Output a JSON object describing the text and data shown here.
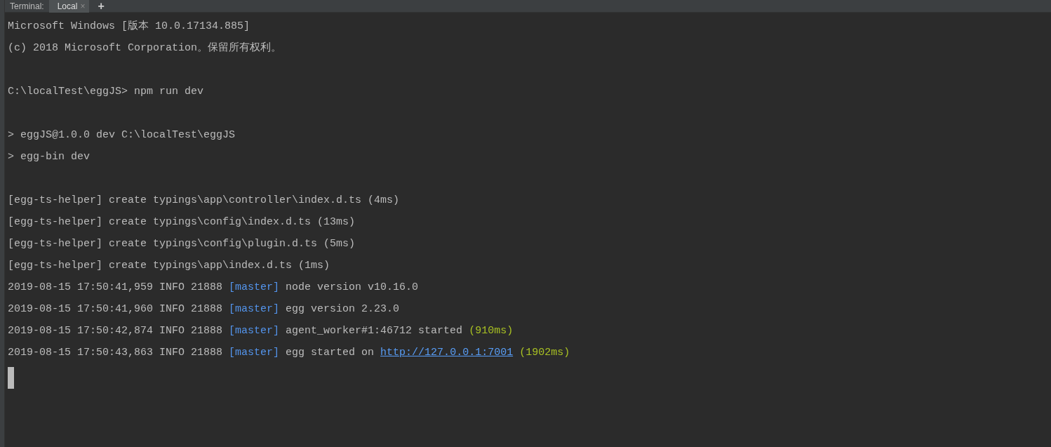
{
  "tool_window": {
    "label": "Terminal:",
    "tabs": [
      {
        "label": "Local",
        "selected": true,
        "close": "×"
      }
    ],
    "add_button": "+"
  },
  "terminal": {
    "lines": [
      {
        "kind": "output",
        "segments": [
          {
            "kind": "text",
            "text": "Microsoft Windows [版本 10.0.17134.885]"
          }
        ]
      },
      {
        "kind": "output",
        "segments": [
          {
            "kind": "text",
            "text": "(c) 2018 Microsoft Corporation。保留所有权利。"
          }
        ]
      },
      {
        "kind": "blank"
      },
      {
        "kind": "output",
        "segments": [
          {
            "kind": "text",
            "text": "C:\\localTest\\eggJS> npm run dev"
          }
        ]
      },
      {
        "kind": "blank"
      },
      {
        "kind": "output",
        "segments": [
          {
            "kind": "text",
            "text": "> eggJS@1.0.0 dev C:\\localTest\\eggJS"
          }
        ]
      },
      {
        "kind": "output",
        "segments": [
          {
            "kind": "text",
            "text": "> egg-bin dev"
          }
        ]
      },
      {
        "kind": "blank"
      },
      {
        "kind": "output",
        "segments": [
          {
            "kind": "text",
            "text": "[egg-ts-helper] create typings\\app\\controller\\index.d.ts (4ms)"
          }
        ]
      },
      {
        "kind": "output",
        "segments": [
          {
            "kind": "text",
            "text": "[egg-ts-helper] create typings\\config\\index.d.ts (13ms)"
          }
        ]
      },
      {
        "kind": "output",
        "segments": [
          {
            "kind": "text",
            "text": "[egg-ts-helper] create typings\\config\\plugin.d.ts (5ms)"
          }
        ]
      },
      {
        "kind": "output",
        "segments": [
          {
            "kind": "text",
            "text": "[egg-ts-helper] create typings\\app\\index.d.ts (1ms)"
          }
        ]
      },
      {
        "kind": "output",
        "segments": [
          {
            "kind": "text",
            "text": "2019-08-15 17:50:41,959 INFO 21888 "
          },
          {
            "kind": "tag",
            "text": "[master]"
          },
          {
            "kind": "text",
            "text": " node version v10.16.0"
          }
        ]
      },
      {
        "kind": "output",
        "segments": [
          {
            "kind": "text",
            "text": "2019-08-15 17:50:41,960 INFO 21888 "
          },
          {
            "kind": "tag",
            "text": "[master]"
          },
          {
            "kind": "text",
            "text": " egg version 2.23.0"
          }
        ]
      },
      {
        "kind": "output",
        "segments": [
          {
            "kind": "text",
            "text": "2019-08-15 17:50:42,874 INFO 21888 "
          },
          {
            "kind": "tag",
            "text": "[master]"
          },
          {
            "kind": "text",
            "text": " agent_worker#1:46712 started "
          },
          {
            "kind": "timing",
            "text": "(910ms)"
          }
        ]
      },
      {
        "kind": "output",
        "segments": [
          {
            "kind": "text",
            "text": "2019-08-15 17:50:43,863 INFO 21888 "
          },
          {
            "kind": "tag",
            "text": "[master]"
          },
          {
            "kind": "text",
            "text": " egg started on "
          },
          {
            "kind": "link",
            "text": "http://127.0.0.1:7001"
          },
          {
            "kind": "timing",
            "text": "(1902ms)"
          }
        ]
      }
    ]
  }
}
